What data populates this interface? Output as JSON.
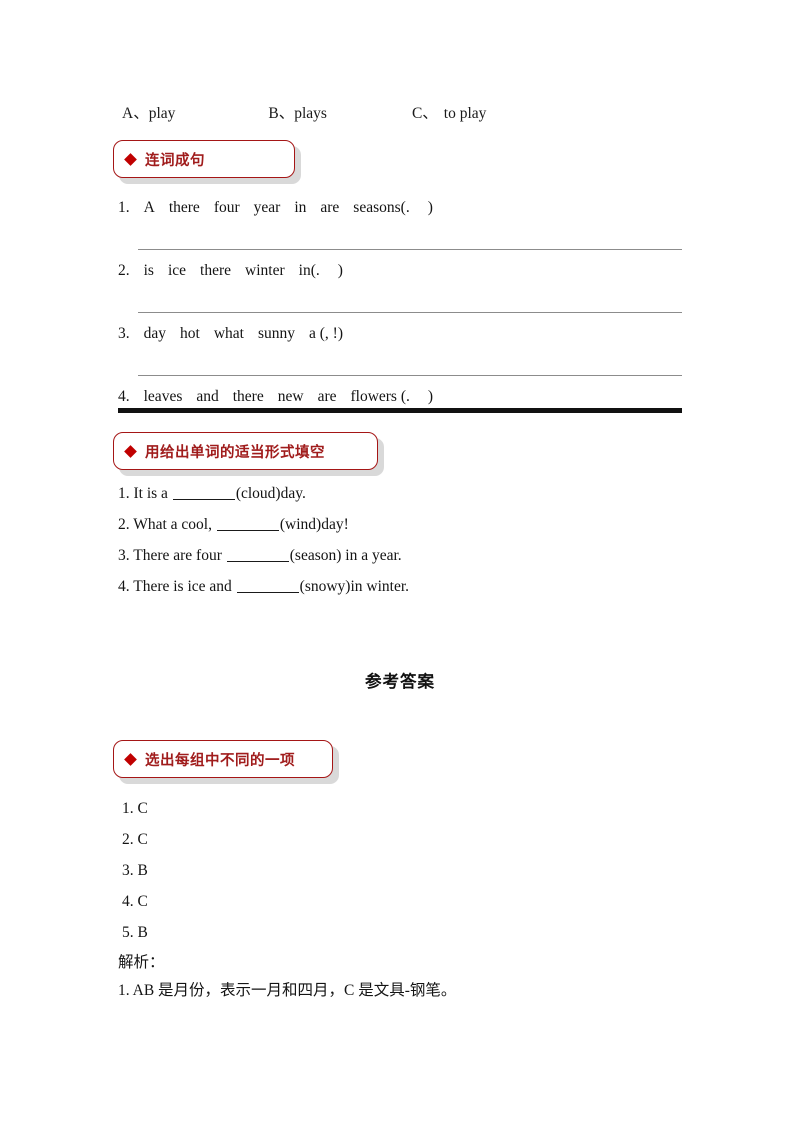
{
  "colors": {
    "badge_border": "#a51616",
    "badge_text": "#a01c1c",
    "badge_diamond": "#c00000",
    "badge_shadow": "#d9d9d9",
    "rule_thin": "#8c8c8c",
    "rule_thick": "#111111"
  },
  "mc_options": {
    "a_label": "A、",
    "a_text": "play",
    "b_label": "B、",
    "b_text": "plays",
    "c_label": "C、",
    "c_text": "to play"
  },
  "section_scramble": {
    "badge_title": "连词成句",
    "items": [
      {
        "number": "1.",
        "words": [
          "A",
          "there",
          "four",
          "year",
          "in",
          "are",
          "seasons(.",
          ")"
        ]
      },
      {
        "number": "2.",
        "words": [
          "is",
          "ice",
          "there",
          "winter",
          "in(.",
          ")"
        ]
      },
      {
        "number": "3.",
        "words": [
          "day",
          "hot",
          "what",
          "sunny",
          "a (, !)"
        ]
      },
      {
        "number": "4.",
        "words": [
          "leaves",
          "and",
          "there",
          "new",
          "are",
          "flowers (.",
          ")"
        ]
      }
    ]
  },
  "section_wordform": {
    "badge_title": "用给出单词的适当形式填空",
    "items": [
      {
        "number": "1.",
        "before": "It is a ",
        "after": "(cloud)day."
      },
      {
        "number": "2.",
        "before": "What a cool, ",
        "after": "(wind)day!"
      },
      {
        "number": "3.",
        "before": "There are four ",
        "after": "(season) in a year."
      },
      {
        "number": "4.",
        "before": "There is ice and ",
        "after": "(snowy)in winter."
      }
    ]
  },
  "answer_key": {
    "heading": "参考答案",
    "badge_title": "选出每组中不同的一项",
    "answers": [
      {
        "number": "1.",
        "value": "C"
      },
      {
        "number": "2.",
        "value": "C"
      },
      {
        "number": "3.",
        "value": "B"
      },
      {
        "number": "4.",
        "value": "C"
      },
      {
        "number": "5.",
        "value": "B"
      }
    ],
    "explain_label": "解析：",
    "explanations": [
      "1. AB 是月份，表示一月和四月，C 是文具-钢笔。"
    ]
  }
}
